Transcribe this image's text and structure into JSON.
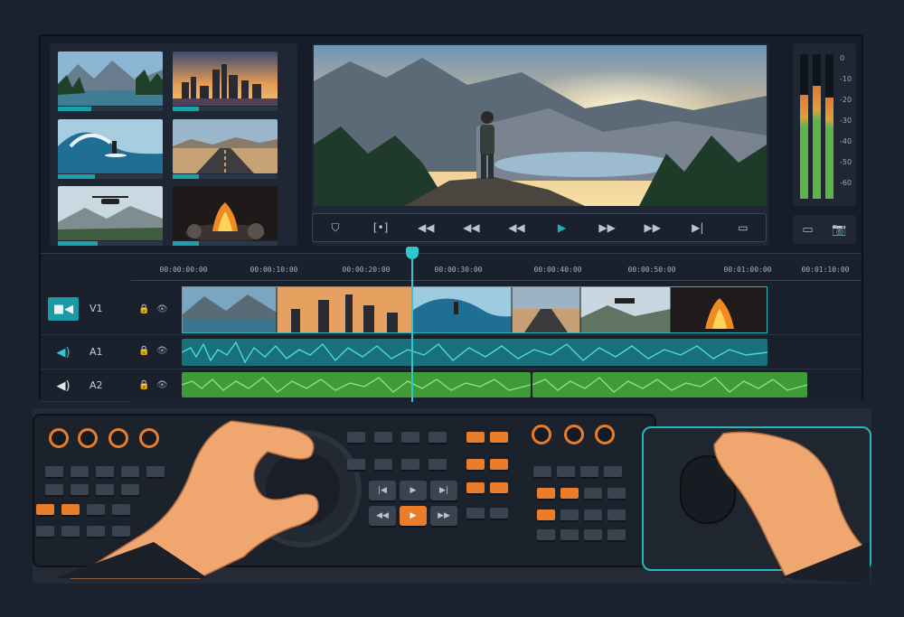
{
  "timeline": {
    "timecodes": [
      "00:00:00:00",
      "00:00:10:00",
      "00:00:20:00",
      "00:00:30:00",
      "00:00:40:00",
      "00:00:50:00",
      "00:01:00:00",
      "00:01:10:00"
    ],
    "tracks": [
      {
        "id": "video",
        "label": "V1",
        "icon": "video-camera-icon"
      },
      {
        "id": "audio1",
        "label": "A1",
        "icon": "speaker-icon"
      },
      {
        "id": "audio2",
        "label": "A2",
        "icon": "speaker-icon"
      }
    ]
  },
  "meters": {
    "scale": [
      "0",
      "-10",
      "-20",
      "-30",
      "-40",
      "-50",
      "-60"
    ],
    "levels": [
      0.72,
      0.78,
      0.7
    ]
  },
  "media_bin": {
    "clips": [
      {
        "name": "mountain-lake",
        "progress": 0.32
      },
      {
        "name": "city-sunset",
        "progress": 0.25
      },
      {
        "name": "surfer-wave",
        "progress": 0.35
      },
      {
        "name": "desert-road",
        "progress": 0.25
      },
      {
        "name": "drone-mountains",
        "progress": 0.38
      },
      {
        "name": "campfire",
        "progress": 0.25
      }
    ]
  },
  "transport": {
    "icons": [
      "shield-icon",
      "in-out-icon",
      "skip-back-icon",
      "rewind-icon",
      "step-back-icon",
      "play-icon",
      "step-forward-icon",
      "fast-forward-icon",
      "skip-end-icon",
      "fullscreen-icon"
    ]
  },
  "colors": {
    "accent": "#1aa2a8",
    "video_clip": "#27b8c1",
    "audio1": "#17707a",
    "audio2": "#3f9a3a",
    "controller_orange": "#ea7c2a"
  }
}
